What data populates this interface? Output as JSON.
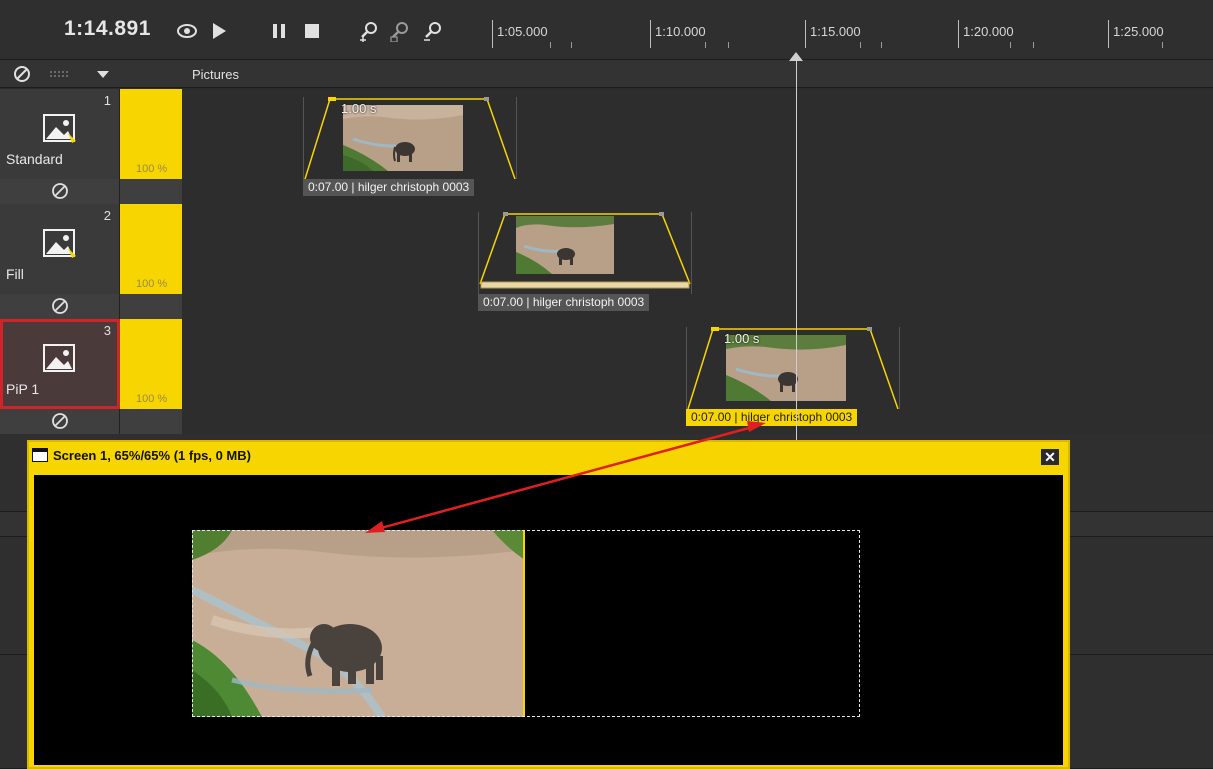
{
  "toolbar": {
    "timecode": "1:14.891",
    "icons": [
      "eye-icon",
      "play-icon",
      "pause-icon",
      "stop-icon",
      "zoom-in-icon",
      "zoom-fit-icon",
      "zoom-out-icon"
    ],
    "ruler_labels": [
      "1:05.000",
      "1:10.000",
      "1:15.000",
      "1:20.000",
      "1:25.000"
    ]
  },
  "pictures_row": {
    "label": "Pictures",
    "buttons": [
      "disable-icon",
      "grid-icon",
      "dropdown-arrow-icon"
    ]
  },
  "tracks": [
    {
      "number": "1",
      "name": "Standard",
      "volume": "100 %",
      "clip": {
        "duration_label": "1.00 s",
        "caption": "0:07.00 | hilger christoph 0003",
        "active": false
      }
    },
    {
      "number": "2",
      "name": "Fill",
      "volume": "100 %",
      "clip": {
        "duration_label": "",
        "caption": "0:07.00 | hilger christoph 0003",
        "active": false
      }
    },
    {
      "number": "3",
      "name": "PiP 1",
      "volume": "100 %",
      "clip": {
        "duration_label": "1.00 s",
        "caption": "0:07.00 | hilger christoph 0003",
        "active": true
      }
    }
  ],
  "screen": {
    "title": "Screen 1, 65%/65% (1 fps, 0 MB)",
    "close_label": "✕"
  },
  "colors": {
    "accent": "#f7d500",
    "selection": "#d0242b",
    "arrow": "#e02020"
  }
}
